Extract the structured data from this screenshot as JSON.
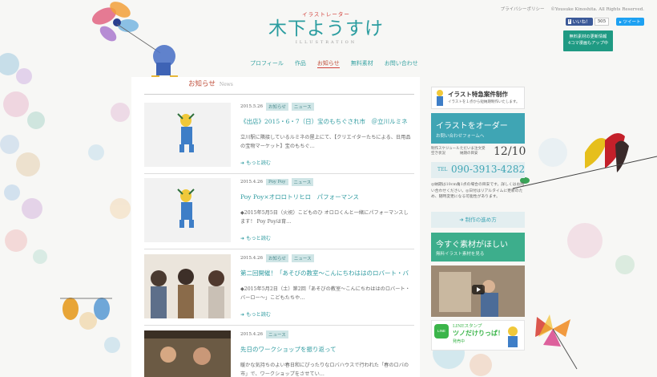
{
  "header": {
    "top_links": [
      "プライバシーポリシー",
      "©Yousuke Kinoshita. All Rights Reserved."
    ],
    "fb_like": "いいね！",
    "fb_count": "505",
    "tweet": "ツイート",
    "badge_line1": "無料素材の更新情報",
    "badge_line2": "4コマ漫画もアップ中",
    "logo_sub": "イラストレーター",
    "logo_main": "木下ようすけ",
    "logo_ill": "ILLUSTRATION"
  },
  "nav": {
    "items": [
      "プロフィール",
      "作品",
      "お知らせ",
      "無料素材",
      "お問い合わせ"
    ],
    "active": "お知らせ"
  },
  "section": {
    "title": "お知らせ",
    "sub": "News"
  },
  "entries": [
    {
      "date": "2015.5.26",
      "tags": [
        "お知らせ",
        "ニュース"
      ],
      "title": "《出店》2015・6・7（日）宝のもちぐされ市　＠立川ルミネ",
      "body": "立川駅に隣接しているルミネの屋上にて、【クリエイターたちによる、日用品の宝物マーケット】宝のもちぐ…",
      "more": "もっと読む"
    },
    {
      "date": "2015.4.26",
      "tags": [
        "Poy Poy",
        "ニュース"
      ],
      "title": "Poy Poy×オロロトリヒロ　パフォーマンス",
      "body": "◆2015年5月5日（火祝）こどものひ オロロくんと一緒にパフォーマンスします！ Poy Poyは育…",
      "more": "もっと読む"
    },
    {
      "date": "2015.4.26",
      "tags": [
        "お知らせ",
        "ニュース"
      ],
      "title": "第二回開催！「あそびの教室〜こんにちわははのロバート・バ",
      "body": "◆2015年5月2日（土）第2回「あそびの教室〜こんにちわははのロバート・バーロー〜」こどもたちや…",
      "more": "もっと読む"
    },
    {
      "date": "2015.4.26",
      "tags": [
        "ニュース"
      ],
      "title": "先日のワークショップを振り返って",
      "body": "暖かな気持ちのよい春日和にぴったりなロバハウスで行われた「春のロバの市」で、ワークショップをさせてい…",
      "more": "もっと読む"
    }
  ],
  "sidebar": {
    "special_title": "イラスト特急案件制作",
    "special_sub": "イラストを１点から短納期制作いたします。",
    "order_title": "イラストをオーダー",
    "order_sub": "お問い合わせフォームへ",
    "next_label1": "制作スケジュール",
    "next_label2": "空き状況",
    "next_label3": "ただいま注文受",
    "next_label4": "納期の目安",
    "next_date": "12/10",
    "tel_label": "TEL",
    "tel": "090-3913-4282",
    "notes": "◎納期は10cm角1点の場合の目安です。詳しくはお問い合わせください。◎日付はリアルタイムに更新のため、随時変更になる可能性があります。",
    "flow": "制作の進め方",
    "material_title": "今すぐ素材がほしい",
    "material_sub": "無料イラスト素材を見る",
    "line_title": "LINEスタンプ",
    "line_main": "ツノだけりっぱ！",
    "line_sub": "発売中"
  },
  "colors": {
    "teal": "#2b9da0",
    "green": "#3daa8a",
    "accent_red": "#d2403a"
  }
}
